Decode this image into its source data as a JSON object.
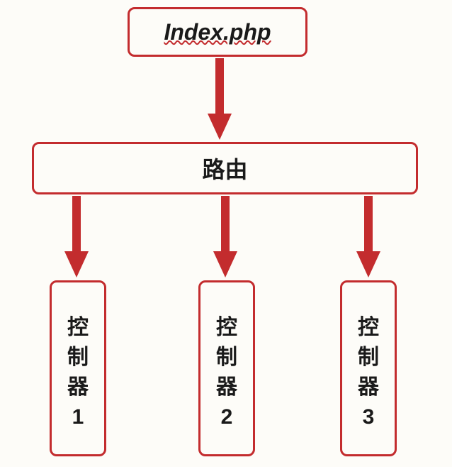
{
  "nodes": {
    "entry": "Index.php",
    "router": "路由",
    "controllers": [
      "控制器1",
      "控制器2",
      "控制器3"
    ]
  },
  "colors": {
    "border": "#c32c2e",
    "arrow": "#c32c2e",
    "text": "#1a1a1a",
    "background": "#fdfcf8"
  }
}
